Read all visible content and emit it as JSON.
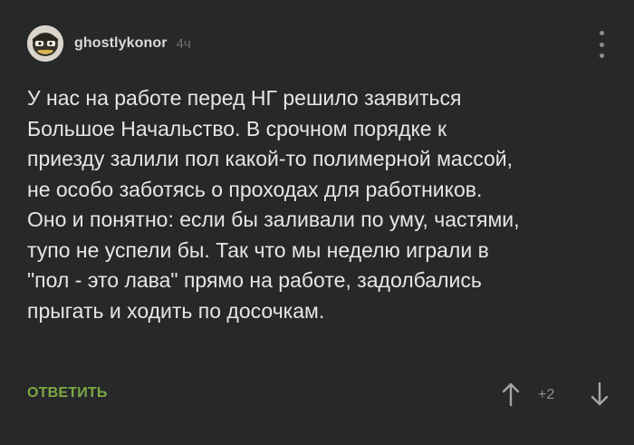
{
  "comment": {
    "author": "ghostlykonor",
    "time": "4ч",
    "avatar_icon": "cartoon-face-avatar",
    "lines": [
      "У нас на работе перед НГ решило заявиться",
      "Большое Начальство. В срочном порядке к",
      "приезду залили пол какой-то полимерной массой,",
      "не особо заботясь о проходах для работников.",
      "Оно и понятно: если бы заливали по уму, частями,",
      "тупо не успели бы. Так что мы неделю играли в",
      "\"пол - это лава\" прямо на работе, задолбались",
      "прыгать и ходить по досочкам."
    ],
    "reply_label": "ОТВЕТИТЬ",
    "rating": "+2"
  },
  "colors": {
    "background": "#26282a",
    "text": "#e6e6e6",
    "accent_green": "#7ea842",
    "muted": "#8e9092"
  },
  "icons": {
    "more": "vertical-dots-icon",
    "upvote": "arrow-up-icon",
    "downvote": "arrow-down-icon"
  }
}
